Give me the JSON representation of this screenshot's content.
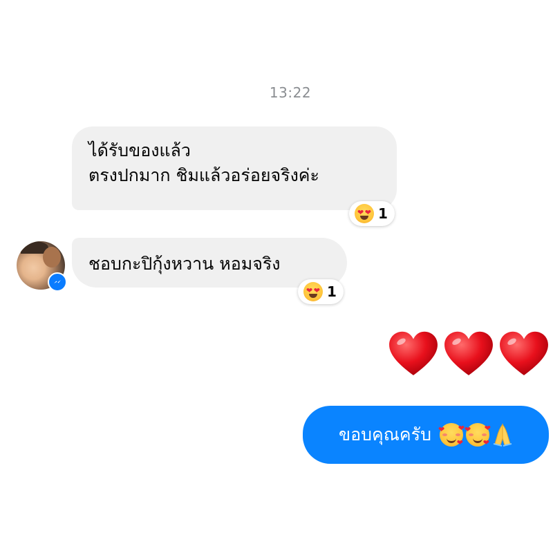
{
  "conversation": {
    "timestamp": "13:22",
    "incoming": [
      {
        "lines": [
          "ได้รับของแล้ว",
          "ตรงปกมาก ชิมแล้วอร่อยจริงค่ะ"
        ],
        "reaction": {
          "icon": "heart-eyes-emoji",
          "count": "1"
        }
      },
      {
        "lines": [
          "ชอบกะปิกุ้งหวาน หอมจริง"
        ],
        "reaction": {
          "icon": "heart-eyes-emoji",
          "count": "1"
        }
      }
    ],
    "sender": {
      "avatar_icon": "profile-photo",
      "badge_icon": "messenger-icon"
    },
    "outgoing_emoji": {
      "icons": [
        "red-heart-emoji",
        "red-heart-emoji",
        "red-heart-emoji"
      ]
    },
    "outgoing": {
      "text": "ขอบคุณครับ",
      "emojis": [
        "smiling-face-with-hearts-emoji",
        "smiling-face-with-hearts-emoji",
        "folded-hands-emoji"
      ]
    }
  },
  "colors": {
    "incoming_bubble": "#f0f0f0",
    "outgoing_bubble": "#0a84ff",
    "timestamp": "#8a8d91",
    "heart": "#e8101c"
  }
}
